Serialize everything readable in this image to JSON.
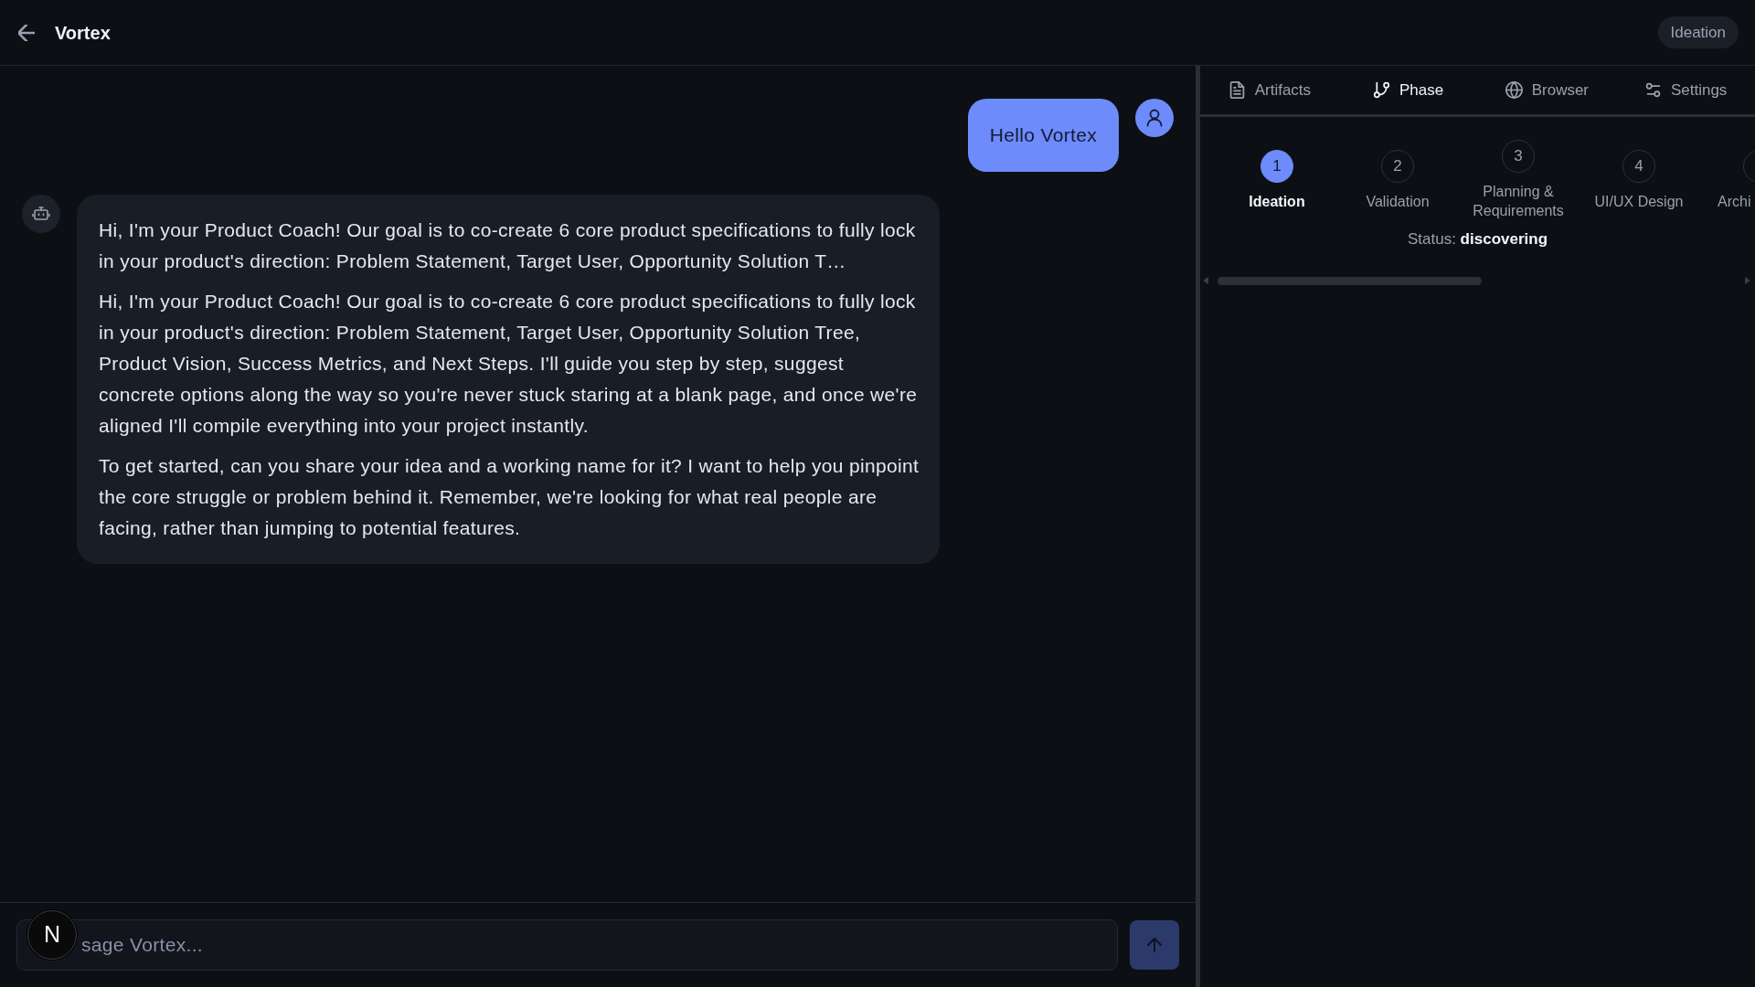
{
  "header": {
    "title": "Vortex",
    "phase_badge": "Ideation"
  },
  "chat": {
    "messages": [
      {
        "kind": "user",
        "text": "Hello Vortex"
      },
      {
        "kind": "assistant",
        "paragraphs": [
          "Hi, I'm your Product Coach! Our goal is to co-create 6 core product specifications to fully lock in your product's direction: Problem Statement, Target User, Opportunity Solution T…",
          "Hi, I'm your Product Coach! Our goal is to co-create 6 core product specifications to fully lock in your product's direction: Problem Statement, Target User, Opportunity Solution Tree, Product Vision, Success Metrics, and Next Steps. I'll guide you step by step, suggest concrete options along the way so you're never stuck staring at a blank page, and once we're aligned I'll compile everything into your project instantly.",
          "To get started, can you share your idea and a working name for it? I want to help you pinpoint the core struggle or problem behind it. Remember, we're looking for what real people are facing, rather than jumping to potential features."
        ]
      }
    ]
  },
  "composer": {
    "placeholder": "sage Vortex...",
    "send_button": {
      "disabled": true
    }
  },
  "dev_tools_button": {
    "label": "N"
  },
  "side_panel": {
    "tabs": [
      {
        "label": "Artifacts",
        "selected": false
      },
      {
        "label": "Phase",
        "selected": true
      },
      {
        "label": "Browser",
        "selected": false
      },
      {
        "label": "Settings",
        "selected": false
      }
    ],
    "steps": [
      {
        "number": "1",
        "label": "Ideation",
        "selected": true
      },
      {
        "number": "2",
        "label": "Validation",
        "selected": false
      },
      {
        "number": "3",
        "label": "Planning & Requirements",
        "selected": false
      },
      {
        "number": "4",
        "label": "UI/UX Design",
        "selected": false
      },
      {
        "label": "Archi",
        "selected": false
      }
    ],
    "status": "Status: **discovering**"
  }
}
